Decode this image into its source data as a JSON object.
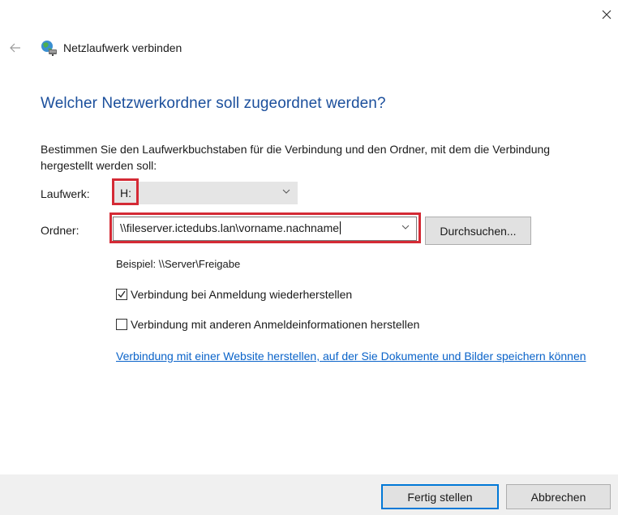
{
  "window": {
    "title": "Netzlaufwerk verbinden",
    "close_icon": "close-icon",
    "back_icon": "back-arrow-icon",
    "app_icon": "network-drive-icon"
  },
  "main": {
    "heading": "Welcher Netzwerkordner soll zugeordnet werden?",
    "description": "Bestimmen Sie den Laufwerkbuchstaben für die Verbindung und den Ordner, mit dem die Verbindung hergestellt werden soll:",
    "drive": {
      "label": "Laufwerk:",
      "value": "H:"
    },
    "folder": {
      "label": "Ordner:",
      "value": "\\\\fileserver.ictedubs.lan\\vorname.nachname",
      "browse_label": "Durchsuchen..."
    },
    "example": "Beispiel: \\\\Server\\Freigabe",
    "options": [
      {
        "label": "Verbindung bei Anmeldung wiederherstellen",
        "checked": true
      },
      {
        "label": "Verbindung mit anderen Anmeldeinformationen herstellen",
        "checked": false
      }
    ],
    "link": "Verbindung mit einer Website herstellen, auf der Sie Dokumente und Bilder speichern können"
  },
  "footer": {
    "finish_label": "Fertig stellen",
    "cancel_label": "Abbrechen"
  },
  "colors": {
    "heading": "#1b4f9c",
    "link": "#0a63c9",
    "highlight": "#d42a35",
    "default_button_border": "#0078d7"
  }
}
